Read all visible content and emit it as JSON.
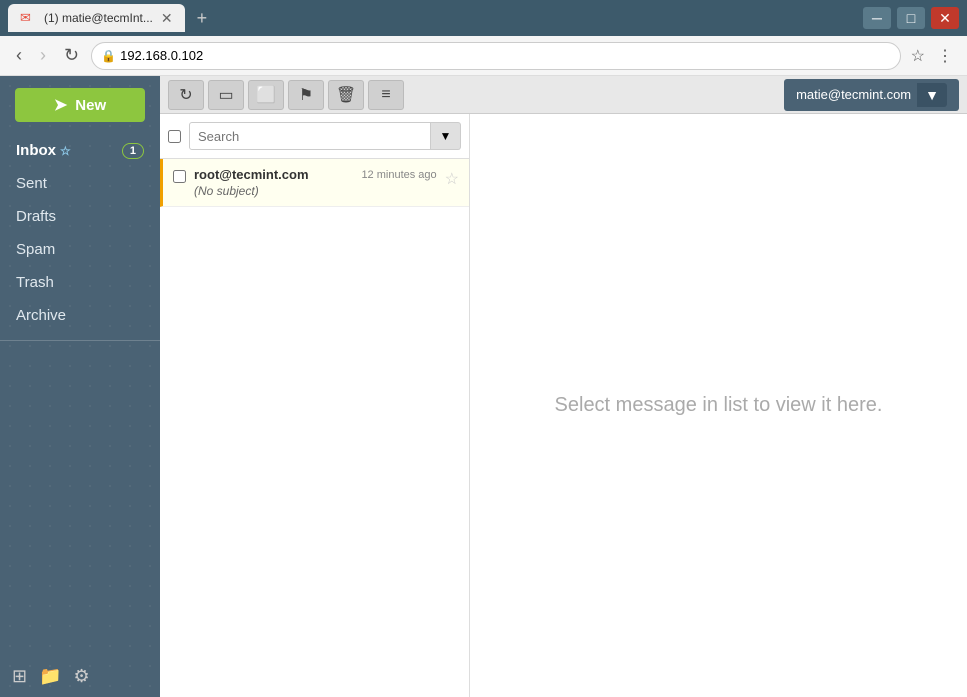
{
  "browser": {
    "tab_title": "(1) matie@tecmInt...",
    "tab_icon": "✉",
    "address": "192.168.0.102",
    "lock_icon": "🔒"
  },
  "toolbar": {
    "refresh_icon": "↻",
    "folder_icon": "📁",
    "archive_icon": "🗄",
    "flag_icon": "⚑",
    "delete_icon": "🗑",
    "menu_icon": "≡",
    "user_email": "matie@tecmint.com",
    "user_dropdown_icon": "▼"
  },
  "sidebar": {
    "compose_label": "New",
    "compose_icon": "➤",
    "nav_items": [
      {
        "label": "Inbox",
        "badge": "1",
        "active": true
      },
      {
        "label": "Sent",
        "badge": "",
        "active": false
      },
      {
        "label": "Drafts",
        "badge": "",
        "active": false
      },
      {
        "label": "Spam",
        "badge": "",
        "active": false
      },
      {
        "label": "Trash",
        "badge": "",
        "active": false
      },
      {
        "label": "Archive",
        "badge": "",
        "active": false
      }
    ],
    "bottom_buttons": [
      {
        "icon": "⊕",
        "name": "expand-icon"
      },
      {
        "icon": "📂",
        "name": "folder-icon"
      },
      {
        "icon": "⚙",
        "name": "settings-icon"
      }
    ]
  },
  "search": {
    "placeholder": "Search",
    "dropdown_icon": "▼"
  },
  "emails": [
    {
      "sender": "root@tecmint.com",
      "time": "12 minutes ago",
      "subject": "(No subject)",
      "starred": false
    }
  ],
  "preview": {
    "empty_message": "Select message in list to view it here."
  }
}
